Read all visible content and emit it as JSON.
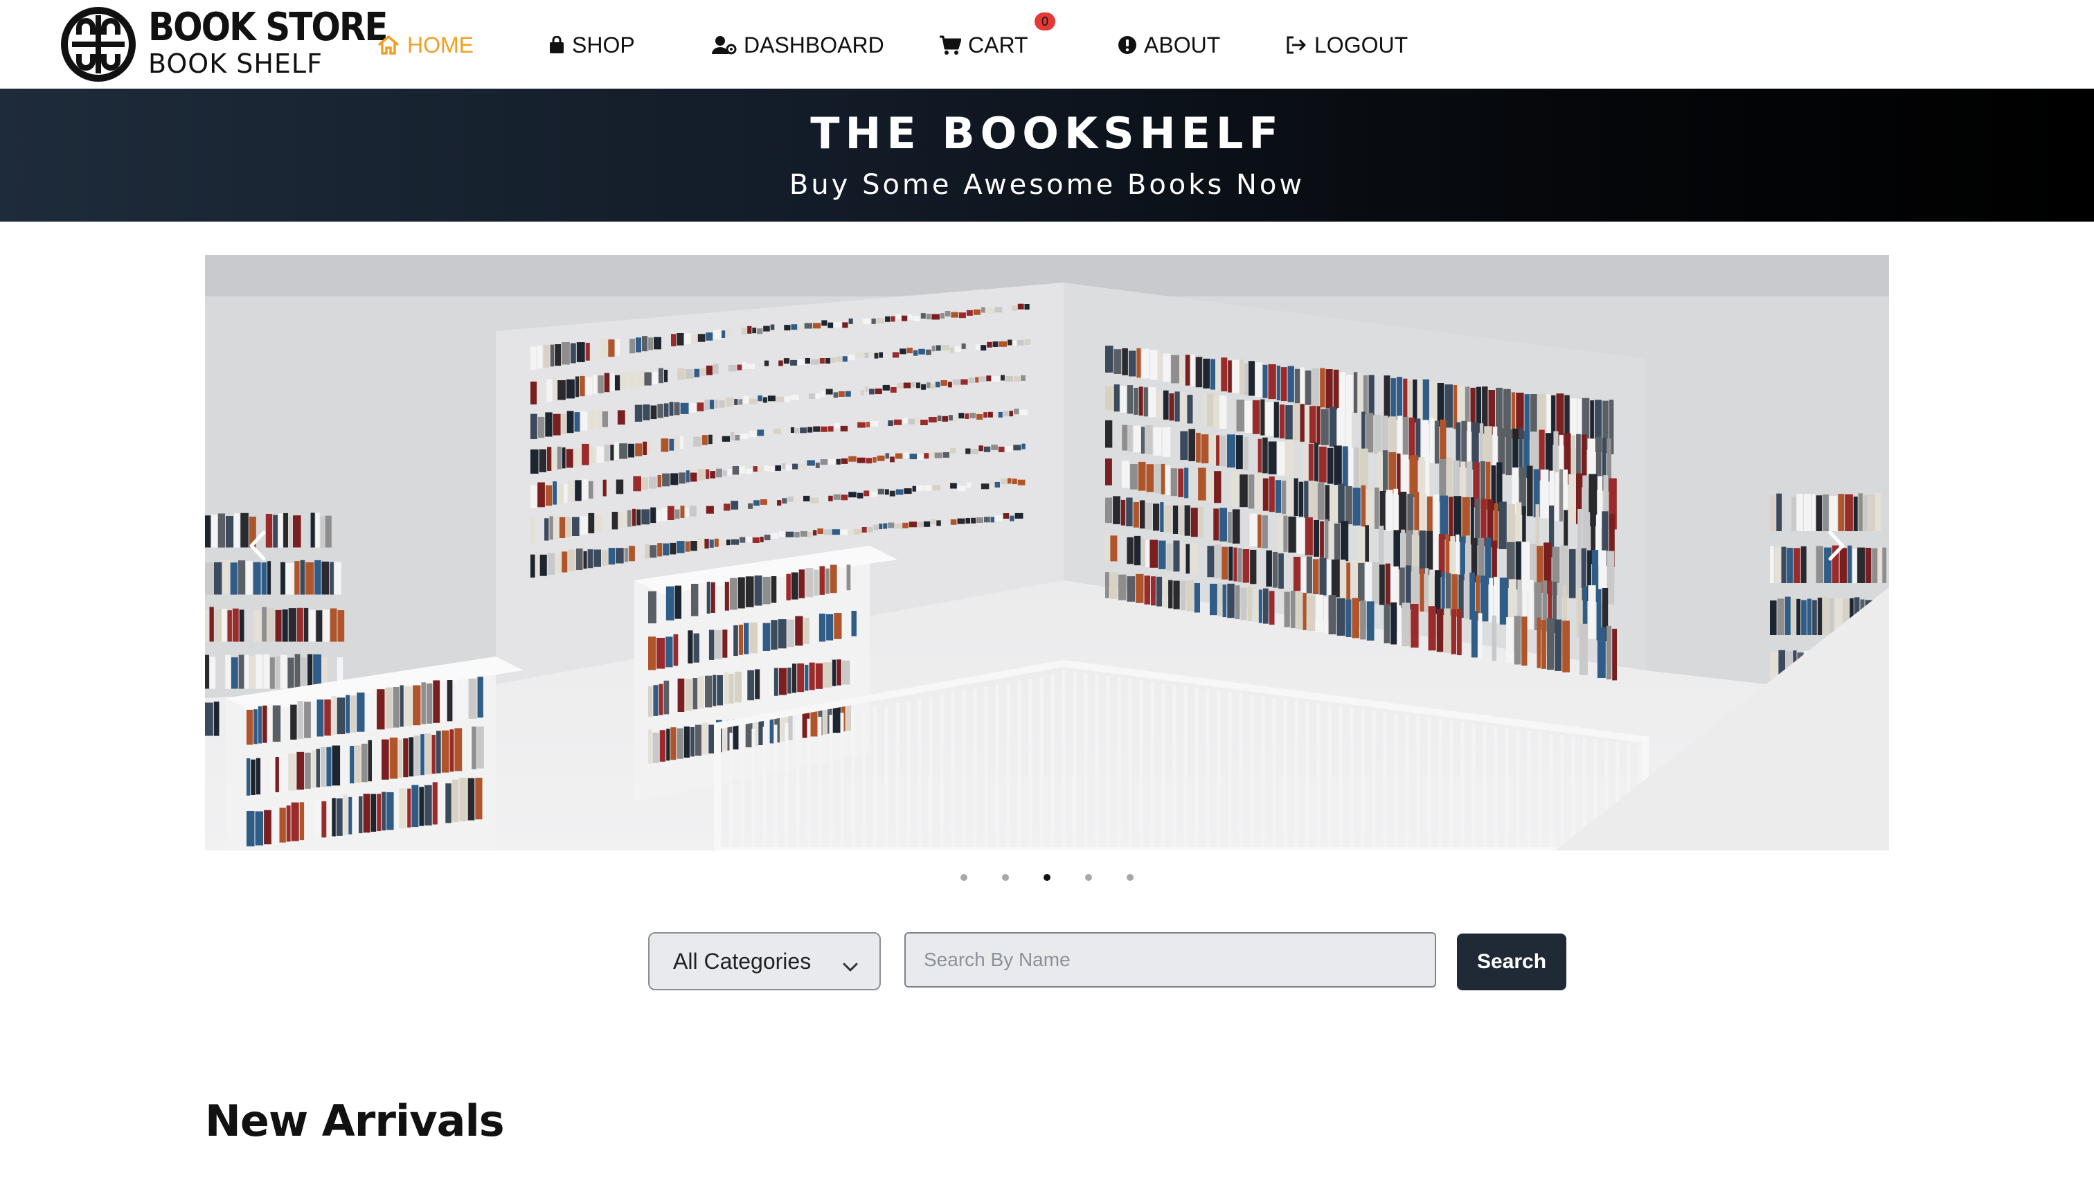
{
  "brand": {
    "title": "BOOK STORE",
    "subtitle": "BOOK SHELF"
  },
  "nav": {
    "home": "HOME",
    "shop": "SHOP",
    "dashboard": "DASHBOARD",
    "cart": "CART",
    "cart_count": "0",
    "about": "ABOUT",
    "logout": "LOGOUT"
  },
  "hero": {
    "title": "THE BOOKSHELF",
    "subtitle": "Buy Some Awesome Books Now"
  },
  "carousel": {
    "slide_count": 5,
    "active_slide": 3,
    "image_description_icon": "library-photo"
  },
  "search": {
    "category_selected": "All Categories",
    "placeholder": "Search By Name",
    "value": "",
    "button_label": "Search"
  },
  "sections": {
    "new_arrivals": "New Arrivals"
  },
  "colors": {
    "accent": "#f0a020",
    "badge": "#e53935",
    "button": "#1f2a36",
    "hero_dark": "#000000"
  }
}
